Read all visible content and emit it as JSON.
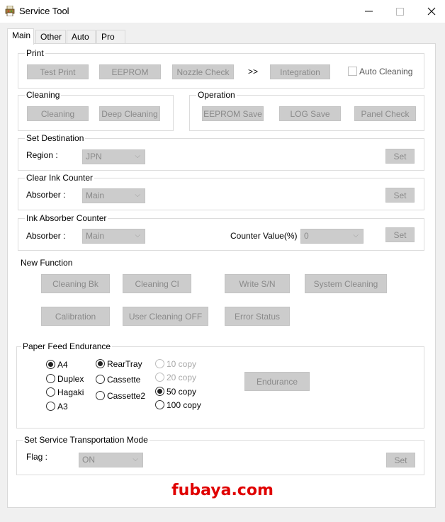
{
  "window": {
    "title": "Service Tool",
    "minimize": "—",
    "maximize": "☐",
    "close": "✕"
  },
  "tabs": [
    "Main",
    "Other",
    "Auto",
    "Pro"
  ],
  "print": {
    "legend": "Print",
    "test_print": "Test Print",
    "eeprom": "EEPROM",
    "nozzle_check": "Nozzle Check",
    "arrows": ">>",
    "integration": "Integration",
    "auto_cleaning": "Auto Cleaning"
  },
  "cleaning": {
    "legend": "Cleaning",
    "cleaning": "Cleaning",
    "deep_cleaning": "Deep Cleaning"
  },
  "operation": {
    "legend": "Operation",
    "eeprom_save": "EEPROM Save",
    "log_save": "LOG Save",
    "panel_check": "Panel Check"
  },
  "set_destination": {
    "legend": "Set Destination",
    "label": "Region :",
    "value": "JPN",
    "set": "Set"
  },
  "clear_ink_counter": {
    "legend": "Clear Ink Counter",
    "label": "Absorber :",
    "value": "Main",
    "set": "Set"
  },
  "ink_absorber_counter": {
    "legend": "Ink Absorber Counter",
    "label": "Absorber :",
    "value": "Main",
    "counter_label": "Counter Value(%) :",
    "counter_value": "0",
    "set": "Set"
  },
  "new_function": {
    "title": "New Function",
    "cleaning_bk": "Cleaning Bk",
    "cleaning_cl": "Cleaning Cl",
    "write_sn": "Write S/N",
    "system_cleaning": "System Cleaning",
    "calibration": "Calibration",
    "user_cleaning_off": "User Cleaning OFF",
    "error_status": "Error Status"
  },
  "paper_feed": {
    "legend": "Paper Feed Endurance",
    "sizes": [
      "A4",
      "Duplex",
      "Hagaki",
      "A3"
    ],
    "sizes_selected": 0,
    "sources": [
      "RearTray",
      "Cassette",
      "Cassette2"
    ],
    "sources_selected": 0,
    "copies": [
      "10 copy",
      "20 copy",
      "50 copy",
      "100 copy"
    ],
    "copies_disabled": [
      true,
      true,
      false,
      false
    ],
    "copies_selected": 2,
    "endurance": "Endurance"
  },
  "transport": {
    "legend": "Set Service Transportation Mode",
    "label": "Flag :",
    "value": "ON",
    "set": "Set"
  },
  "watermark": "fubaya.com",
  "colors": {
    "disabled_button": "#cccccc",
    "watermark": "#e00000"
  },
  "icons": {
    "app": "printer-app-icon",
    "dropdown": "chevron-down-icon"
  }
}
